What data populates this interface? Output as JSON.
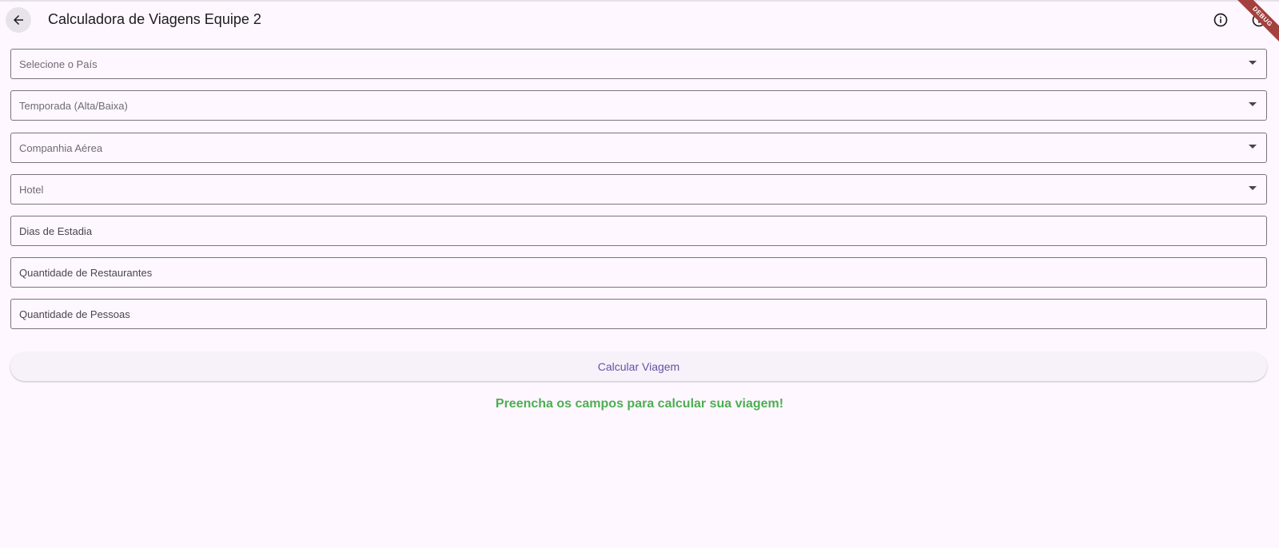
{
  "appbar": {
    "title": "Calculadora de Viagens Equipe 2",
    "back_icon": "arrow-back-icon",
    "actions": [
      {
        "icon": "info-icon"
      },
      {
        "icon": "info-icon"
      }
    ],
    "debug_banner": "DEBUG"
  },
  "form": {
    "country": {
      "placeholder": "Selecione o País"
    },
    "season": {
      "placeholder": "Temporada (Alta/Baixa)"
    },
    "airline": {
      "placeholder": "Companhia Aérea"
    },
    "hotel": {
      "placeholder": "Hotel"
    },
    "days": {
      "label": "Dias de Estadia"
    },
    "restaurants": {
      "label": "Quantidade de Restaurantes"
    },
    "people": {
      "label": "Quantidade de Pessoas"
    }
  },
  "button": {
    "label": "Calcular Viagem"
  },
  "message": "Preencha os campos para calcular sua viagem!",
  "colors": {
    "background": "#FEF7FF",
    "accent": "#6750A4",
    "message": "#4CAF50",
    "debug_banner": "#A3413F"
  }
}
